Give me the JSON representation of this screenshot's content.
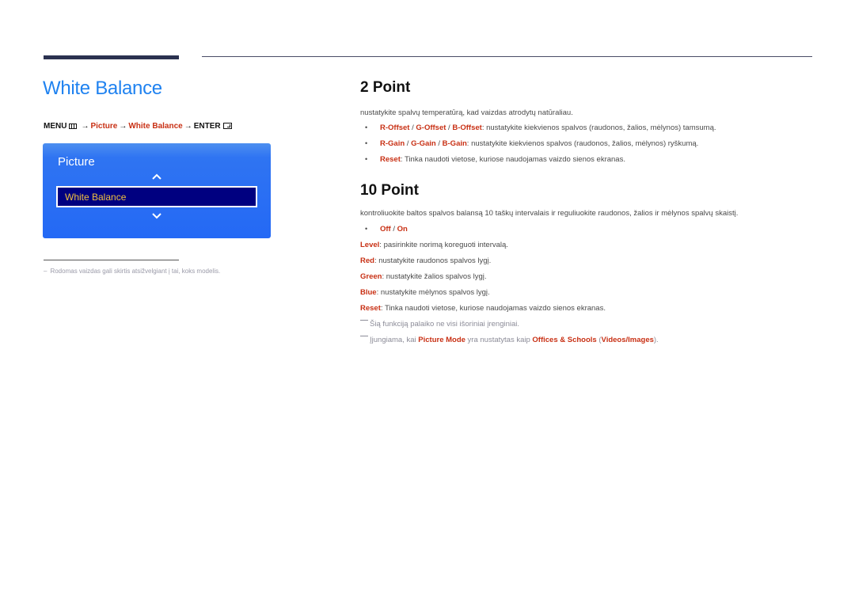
{
  "page_title": "White Balance",
  "menu_path": {
    "menu": "MENU",
    "arrow": "→",
    "step1": "Picture",
    "step2": "White Balance",
    "enter": "ENTER"
  },
  "osd": {
    "title": "Picture",
    "selected_item": "White Balance",
    "icons": [
      "chevron-up-icon",
      "chevron-down-icon"
    ]
  },
  "footnote": {
    "dash": "–",
    "text": "Rodomas vaizdas gali skirtis atsižvelgiant į tai, koks modelis."
  },
  "two_point": {
    "heading": "2 Point",
    "intro": "nustatykite spalvų temperatūrą, kad vaizdas atrodytų natūraliau.",
    "bullet": "•",
    "items": [
      {
        "k1": "R-Offset",
        "k2": "G-Offset",
        "k3": "B-Offset",
        "text": ": nustatykite kiekvienos spalvos (raudonos, žalios, mėlynos) tamsumą."
      },
      {
        "k1": "R-Gain",
        "k2": "G-Gain",
        "k3": "B-Gain",
        "text": ": nustatykite kiekvienos spalvos (raudonos, žalios, mėlynos) ryškumą."
      },
      {
        "k1": "Reset",
        "text": ": Tinka naudoti vietose, kuriose naudojamas vaizdo sienos ekranas."
      }
    ],
    "separator": " / "
  },
  "ten_point": {
    "heading": "10 Point",
    "intro": "kontroliuokite baltos spalvos balansą 10 taškų intervalais ir reguliuokite raudonos, žalios ir mėlynos spalvų skaistį.",
    "options": {
      "off": "Off",
      "on": "On",
      "separator": " / "
    },
    "settings": [
      {
        "key": "Level",
        "text": ": pasirinkite norimą koreguoti intervalą."
      },
      {
        "key": "Red",
        "text": ": nustatykite raudonos spalvos lygį."
      },
      {
        "key": "Green",
        "text": ": nustatykite žalios spalvos lygį."
      },
      {
        "key": "Blue",
        "text": ": nustatykite mėlynos spalvos lygį."
      },
      {
        "key": "Reset",
        "text": ": Tinka naudoti vietose, kuriose naudojamas vaizdo sienos ekranas."
      }
    ],
    "notes": {
      "note1": "Šią funkciją palaiko ne visi išoriniai įrenginiai.",
      "note2_pre": "Įjungiama, kai ",
      "note2_k1": "Picture Mode",
      "note2_mid": " yra nustatytas kaip ",
      "note2_k2": "Offices & Schools",
      "note2_open": " (",
      "note2_k3": "Videos/Images",
      "note2_close": ")."
    }
  },
  "colors": {
    "title_blue": "#1f82f0",
    "keyword_red": "#c83014",
    "osd_blue": "#2469f5",
    "osd_selected": "#000080",
    "osd_selected_text": "#f0c040"
  }
}
